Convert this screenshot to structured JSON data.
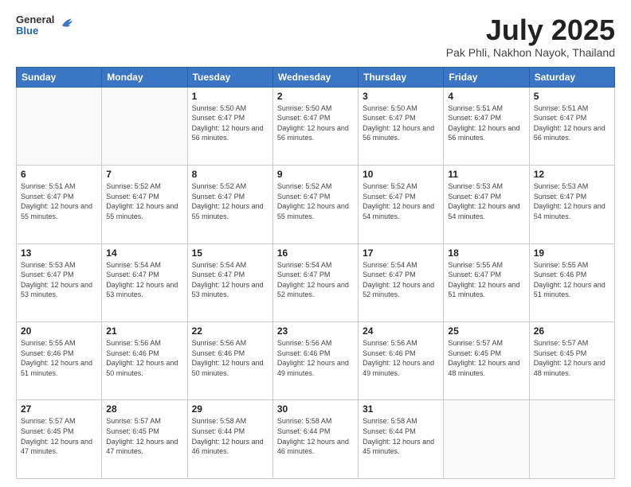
{
  "header": {
    "logo": {
      "general": "General",
      "blue": "Blue"
    },
    "title": "July 2025",
    "location": "Pak Phli, Nakhon Nayok, Thailand"
  },
  "calendar": {
    "days_of_week": [
      "Sunday",
      "Monday",
      "Tuesday",
      "Wednesday",
      "Thursday",
      "Friday",
      "Saturday"
    ],
    "weeks": [
      [
        {
          "day": "",
          "info": ""
        },
        {
          "day": "",
          "info": ""
        },
        {
          "day": "1",
          "info": "Sunrise: 5:50 AM\nSunset: 6:47 PM\nDaylight: 12 hours and 56 minutes."
        },
        {
          "day": "2",
          "info": "Sunrise: 5:50 AM\nSunset: 6:47 PM\nDaylight: 12 hours and 56 minutes."
        },
        {
          "day": "3",
          "info": "Sunrise: 5:50 AM\nSunset: 6:47 PM\nDaylight: 12 hours and 56 minutes."
        },
        {
          "day": "4",
          "info": "Sunrise: 5:51 AM\nSunset: 6:47 PM\nDaylight: 12 hours and 56 minutes."
        },
        {
          "day": "5",
          "info": "Sunrise: 5:51 AM\nSunset: 6:47 PM\nDaylight: 12 hours and 56 minutes."
        }
      ],
      [
        {
          "day": "6",
          "info": "Sunrise: 5:51 AM\nSunset: 6:47 PM\nDaylight: 12 hours and 55 minutes."
        },
        {
          "day": "7",
          "info": "Sunrise: 5:52 AM\nSunset: 6:47 PM\nDaylight: 12 hours and 55 minutes."
        },
        {
          "day": "8",
          "info": "Sunrise: 5:52 AM\nSunset: 6:47 PM\nDaylight: 12 hours and 55 minutes."
        },
        {
          "day": "9",
          "info": "Sunrise: 5:52 AM\nSunset: 6:47 PM\nDaylight: 12 hours and 55 minutes."
        },
        {
          "day": "10",
          "info": "Sunrise: 5:52 AM\nSunset: 6:47 PM\nDaylight: 12 hours and 54 minutes."
        },
        {
          "day": "11",
          "info": "Sunrise: 5:53 AM\nSunset: 6:47 PM\nDaylight: 12 hours and 54 minutes."
        },
        {
          "day": "12",
          "info": "Sunrise: 5:53 AM\nSunset: 6:47 PM\nDaylight: 12 hours and 54 minutes."
        }
      ],
      [
        {
          "day": "13",
          "info": "Sunrise: 5:53 AM\nSunset: 6:47 PM\nDaylight: 12 hours and 53 minutes."
        },
        {
          "day": "14",
          "info": "Sunrise: 5:54 AM\nSunset: 6:47 PM\nDaylight: 12 hours and 53 minutes."
        },
        {
          "day": "15",
          "info": "Sunrise: 5:54 AM\nSunset: 6:47 PM\nDaylight: 12 hours and 53 minutes."
        },
        {
          "day": "16",
          "info": "Sunrise: 5:54 AM\nSunset: 6:47 PM\nDaylight: 12 hours and 52 minutes."
        },
        {
          "day": "17",
          "info": "Sunrise: 5:54 AM\nSunset: 6:47 PM\nDaylight: 12 hours and 52 minutes."
        },
        {
          "day": "18",
          "info": "Sunrise: 5:55 AM\nSunset: 6:47 PM\nDaylight: 12 hours and 51 minutes."
        },
        {
          "day": "19",
          "info": "Sunrise: 5:55 AM\nSunset: 6:46 PM\nDaylight: 12 hours and 51 minutes."
        }
      ],
      [
        {
          "day": "20",
          "info": "Sunrise: 5:55 AM\nSunset: 6:46 PM\nDaylight: 12 hours and 51 minutes."
        },
        {
          "day": "21",
          "info": "Sunrise: 5:56 AM\nSunset: 6:46 PM\nDaylight: 12 hours and 50 minutes."
        },
        {
          "day": "22",
          "info": "Sunrise: 5:56 AM\nSunset: 6:46 PM\nDaylight: 12 hours and 50 minutes."
        },
        {
          "day": "23",
          "info": "Sunrise: 5:56 AM\nSunset: 6:46 PM\nDaylight: 12 hours and 49 minutes."
        },
        {
          "day": "24",
          "info": "Sunrise: 5:56 AM\nSunset: 6:46 PM\nDaylight: 12 hours and 49 minutes."
        },
        {
          "day": "25",
          "info": "Sunrise: 5:57 AM\nSunset: 6:45 PM\nDaylight: 12 hours and 48 minutes."
        },
        {
          "day": "26",
          "info": "Sunrise: 5:57 AM\nSunset: 6:45 PM\nDaylight: 12 hours and 48 minutes."
        }
      ],
      [
        {
          "day": "27",
          "info": "Sunrise: 5:57 AM\nSunset: 6:45 PM\nDaylight: 12 hours and 47 minutes."
        },
        {
          "day": "28",
          "info": "Sunrise: 5:57 AM\nSunset: 6:45 PM\nDaylight: 12 hours and 47 minutes."
        },
        {
          "day": "29",
          "info": "Sunrise: 5:58 AM\nSunset: 6:44 PM\nDaylight: 12 hours and 46 minutes."
        },
        {
          "day": "30",
          "info": "Sunrise: 5:58 AM\nSunset: 6:44 PM\nDaylight: 12 hours and 46 minutes."
        },
        {
          "day": "31",
          "info": "Sunrise: 5:58 AM\nSunset: 6:44 PM\nDaylight: 12 hours and 45 minutes."
        },
        {
          "day": "",
          "info": ""
        },
        {
          "day": "",
          "info": ""
        }
      ]
    ]
  }
}
